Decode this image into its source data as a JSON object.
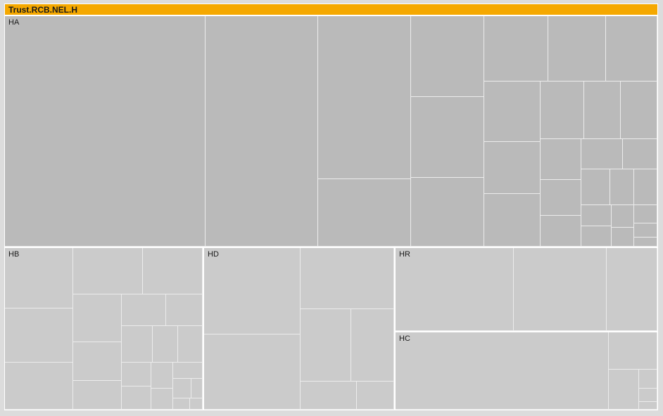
{
  "chart_data": {
    "type": "treemap",
    "title": "Trust.RCB.NEL.H",
    "colors": {
      "header": "#f5a800",
      "group_dark": "#bababa",
      "group_light": "#cbcbcb",
      "divider": "#ffffff"
    },
    "groups": [
      {
        "name": "HA",
        "shade": "dark",
        "values": [
          110,
          62,
          36,
          15,
          14,
          14,
          12,
          10,
          9,
          8,
          8,
          7,
          7,
          6,
          5,
          5,
          4,
          3.5,
          3,
          3,
          2.5,
          2.5,
          2,
          2,
          1.5,
          1.5,
          1.2,
          1,
          1,
          0.8,
          0.5
        ]
      },
      {
        "name": "HB",
        "shade": "light",
        "values": [
          9,
          8,
          7,
          7,
          6,
          5,
          4,
          3,
          3,
          2.5,
          2.5,
          2,
          2,
          1.5,
          1.5,
          1.2,
          1,
          1,
          0.8,
          0.5,
          0.4,
          0.3
        ]
      },
      {
        "name": "HD",
        "shade": "light",
        "values": [
          16,
          14,
          11,
          7,
          6,
          3,
          2
        ]
      },
      {
        "name": "HR",
        "shade": "light",
        "values": [
          14,
          11,
          6
        ]
      },
      {
        "name": "HC",
        "shade": "light",
        "values": [
          55,
          6,
          4,
          1.2,
          0.8,
          0.5
        ]
      }
    ]
  }
}
